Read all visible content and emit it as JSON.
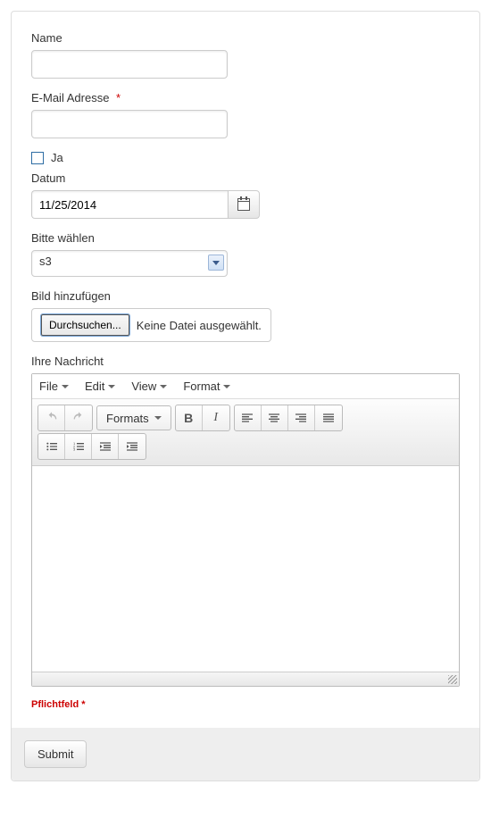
{
  "name": {
    "label": "Name",
    "value": ""
  },
  "email": {
    "label": "E-Mail Adresse",
    "value": ""
  },
  "ja": {
    "label": "Ja",
    "checked": false
  },
  "datum": {
    "label": "Datum",
    "value": "11/25/2014"
  },
  "select": {
    "label": "Bitte wählen",
    "value": "s3"
  },
  "file": {
    "label": "Bild hinzufügen",
    "button": "Durchsuchen...",
    "status": "Keine Datei ausgewählt."
  },
  "message": {
    "label": "Ihre Nachricht"
  },
  "editor": {
    "menu": {
      "file": "File",
      "edit": "Edit",
      "view": "View",
      "format": "Format"
    },
    "formats_btn": "Formats"
  },
  "pflicht": "Pflichtfeld *",
  "submit": "Submit"
}
